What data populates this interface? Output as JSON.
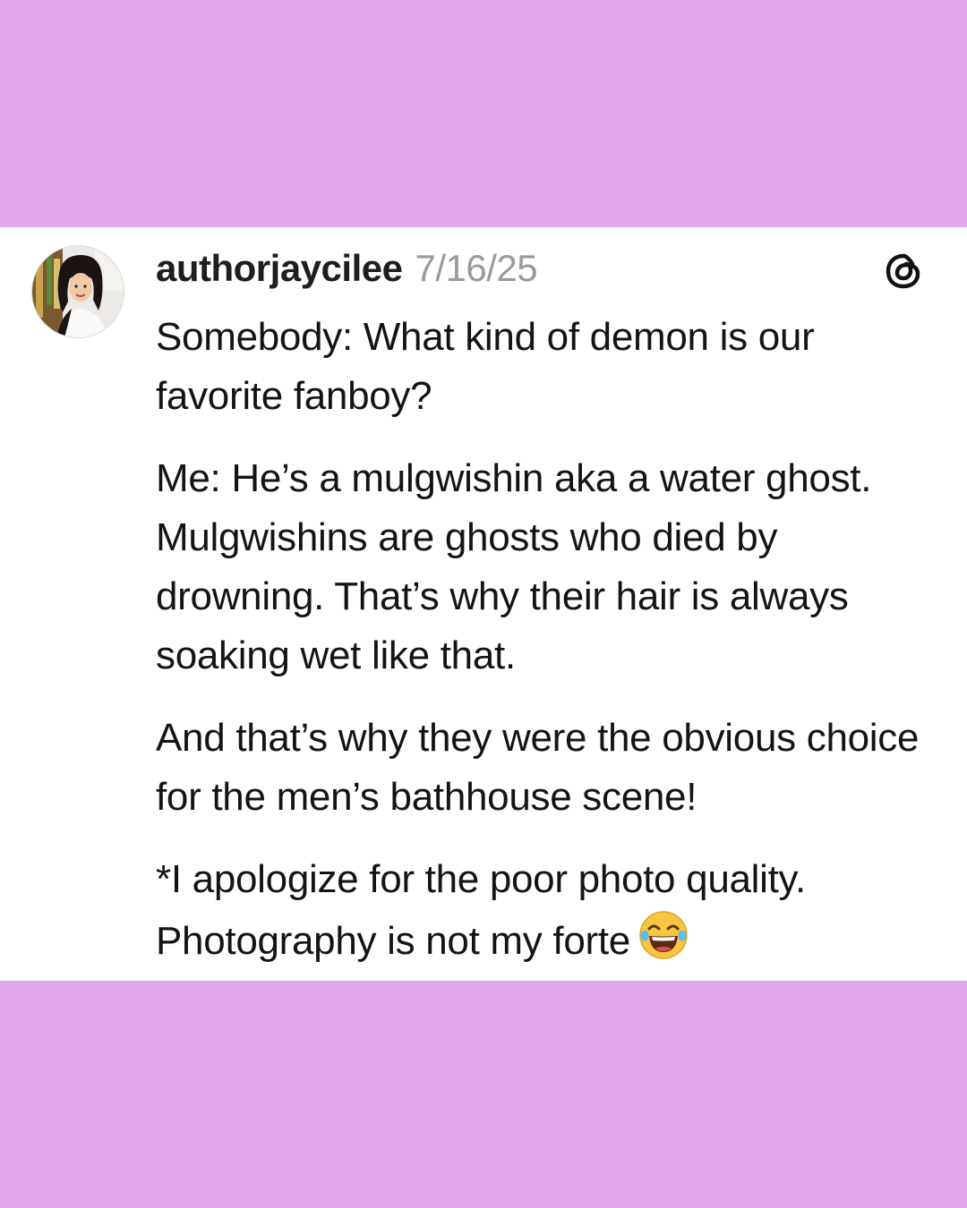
{
  "post": {
    "username": "authorjaycilee",
    "date": "7/16/25",
    "paragraphs": [
      "Somebody: What kind of demon is our favorite fanboy?",
      "Me: He’s a mulgwishin aka a water ghost. Mulgwishins are ghosts who died by drowning. That’s why their hair is always soaking wet like that.",
      "And that’s why they were the obvious choice for the men’s bathhouse scene!",
      "*I apologize for the poor photo quality. Photography is not my forte"
    ],
    "trailing_emoji": "face-with-tears-of-joy"
  },
  "icons": {
    "brand": "threads-icon",
    "avatar": "avatar-photo"
  },
  "colors": {
    "background": "#e2a9ee",
    "card": "#ffffff",
    "username": "#1e1e1e",
    "date": "#9a9a9a",
    "text": "#141414"
  }
}
